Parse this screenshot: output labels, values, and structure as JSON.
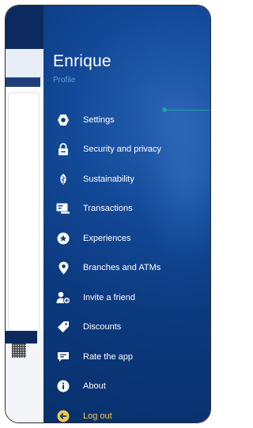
{
  "drawer": {
    "user_name": "Enrique",
    "section_label": "Profile",
    "items": [
      {
        "label": "Settings",
        "icon": "gear-icon"
      },
      {
        "label": "Security and privacy",
        "icon": "lock-icon"
      },
      {
        "label": "Sustainability",
        "icon": "leaf-icon"
      },
      {
        "label": "Transactions",
        "icon": "transactions-icon"
      },
      {
        "label": "Experiences",
        "icon": "star-badge-icon"
      },
      {
        "label": "Branches and ATMs",
        "icon": "location-pin-icon"
      },
      {
        "label": "Invite a friend",
        "icon": "add-person-icon"
      },
      {
        "label": "Discounts",
        "icon": "tag-icon"
      },
      {
        "label": "Rate the app",
        "icon": "rate-message-icon"
      },
      {
        "label": "About",
        "icon": "info-icon"
      },
      {
        "label": "Log out",
        "icon": "logout-arrow-icon"
      }
    ]
  },
  "colors": {
    "drawer_background": "#0c3a7f",
    "section_label": "#6b9bd8",
    "logout_accent": "#f7c948",
    "annotation": "#1aa5a0"
  }
}
